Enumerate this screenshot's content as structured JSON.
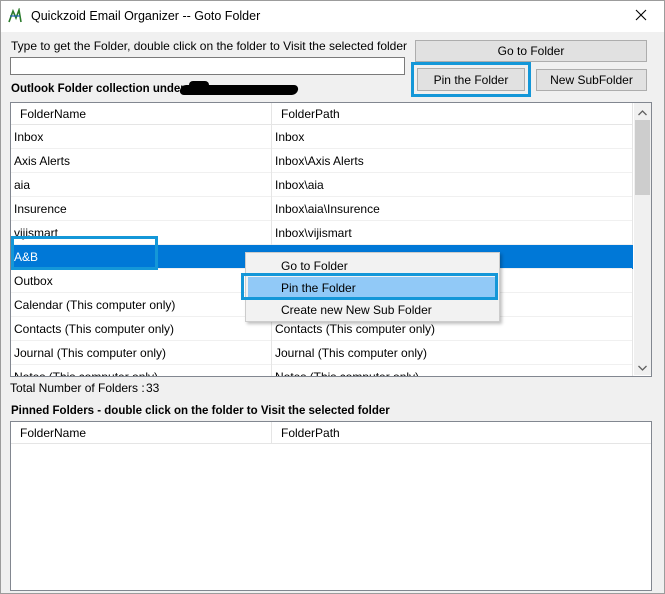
{
  "window": {
    "title": "Quickzoid Email Organizer -- Goto Folder",
    "icons": {
      "app": "app-icon",
      "close": "close-icon"
    }
  },
  "search": {
    "label": "Type to get the Folder, double click on the folder to Visit the selected folder",
    "value": ""
  },
  "buttons": {
    "goto": "Go to Folder",
    "pin": "Pin the Folder",
    "new_sub": "New SubFolder"
  },
  "folders_section": {
    "label": "Outlook Folder collection under",
    "columns": [
      "FolderName",
      "FolderPath"
    ],
    "rows": [
      {
        "name": "Inbox",
        "path": "Inbox"
      },
      {
        "name": "Axis Alerts",
        "path": "Inbox\\Axis Alerts"
      },
      {
        "name": "aia",
        "path": "Inbox\\aia"
      },
      {
        "name": "Insurence",
        "path": "Inbox\\aia\\Insurence"
      },
      {
        "name": "vijismart",
        "path": "Inbox\\vijismart"
      },
      {
        "name": "A&B",
        "path": ""
      },
      {
        "name": "Outbox",
        "path": ""
      },
      {
        "name": "Calendar (This computer only)",
        "path": ""
      },
      {
        "name": "Contacts (This computer only)",
        "path": "Contacts (This computer only)"
      },
      {
        "name": "Journal (This computer only)",
        "path": "Journal (This computer only)"
      },
      {
        "name": "Notes (This computer only)",
        "path": "Notes (This computer only)"
      }
    ],
    "selected_index": 5
  },
  "context_menu": {
    "items": [
      "Go to Folder",
      "Pin the Folder",
      "Create new New Sub Folder"
    ],
    "hot_index": 1
  },
  "total": {
    "label": "Total Number of Folders :",
    "count": "33"
  },
  "pinned_section": {
    "label": "Pinned Folders - double click on the folder to Visit the selected folder",
    "columns": [
      "FolderName",
      "FolderPath"
    ]
  },
  "colors": {
    "selection": "#0078d7",
    "highlight_box": "#1497d8",
    "menu_hot": "#91c9f7"
  }
}
